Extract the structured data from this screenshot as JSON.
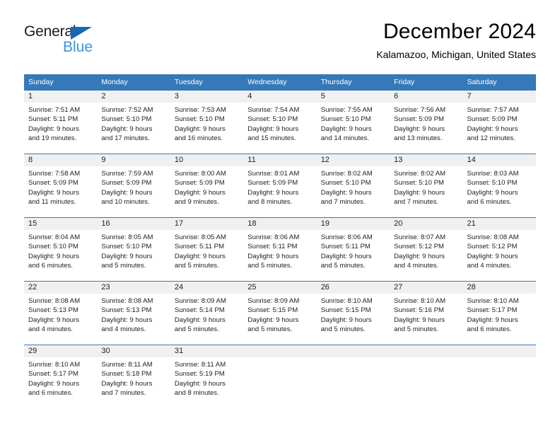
{
  "brand": {
    "word_one": "General",
    "word_two": "Blue",
    "triangle_icon": "brand-triangle-icon",
    "accent_dark": "#1668b3",
    "accent_light": "#3d93d8"
  },
  "header": {
    "title": "December 2024",
    "subtitle": "Kalamazoo, Michigan, United States"
  },
  "theme": {
    "header_blue": "#3579b8",
    "daynum_gray": "#f0f0f0",
    "text": "#222222"
  },
  "weekdays": [
    "Sunday",
    "Monday",
    "Tuesday",
    "Wednesday",
    "Thursday",
    "Friday",
    "Saturday"
  ],
  "weeks": [
    [
      {
        "day": "1",
        "sunrise": "Sunrise: 7:51 AM",
        "sunset": "Sunset: 5:11 PM",
        "daylight_line1": "Daylight: 9 hours",
        "daylight_line2": "and 19 minutes."
      },
      {
        "day": "2",
        "sunrise": "Sunrise: 7:52 AM",
        "sunset": "Sunset: 5:10 PM",
        "daylight_line1": "Daylight: 9 hours",
        "daylight_line2": "and 17 minutes."
      },
      {
        "day": "3",
        "sunrise": "Sunrise: 7:53 AM",
        "sunset": "Sunset: 5:10 PM",
        "daylight_line1": "Daylight: 9 hours",
        "daylight_line2": "and 16 minutes."
      },
      {
        "day": "4",
        "sunrise": "Sunrise: 7:54 AM",
        "sunset": "Sunset: 5:10 PM",
        "daylight_line1": "Daylight: 9 hours",
        "daylight_line2": "and 15 minutes."
      },
      {
        "day": "5",
        "sunrise": "Sunrise: 7:55 AM",
        "sunset": "Sunset: 5:10 PM",
        "daylight_line1": "Daylight: 9 hours",
        "daylight_line2": "and 14 minutes."
      },
      {
        "day": "6",
        "sunrise": "Sunrise: 7:56 AM",
        "sunset": "Sunset: 5:09 PM",
        "daylight_line1": "Daylight: 9 hours",
        "daylight_line2": "and 13 minutes."
      },
      {
        "day": "7",
        "sunrise": "Sunrise: 7:57 AM",
        "sunset": "Sunset: 5:09 PM",
        "daylight_line1": "Daylight: 9 hours",
        "daylight_line2": "and 12 minutes."
      }
    ],
    [
      {
        "day": "8",
        "sunrise": "Sunrise: 7:58 AM",
        "sunset": "Sunset: 5:09 PM",
        "daylight_line1": "Daylight: 9 hours",
        "daylight_line2": "and 11 minutes."
      },
      {
        "day": "9",
        "sunrise": "Sunrise: 7:59 AM",
        "sunset": "Sunset: 5:09 PM",
        "daylight_line1": "Daylight: 9 hours",
        "daylight_line2": "and 10 minutes."
      },
      {
        "day": "10",
        "sunrise": "Sunrise: 8:00 AM",
        "sunset": "Sunset: 5:09 PM",
        "daylight_line1": "Daylight: 9 hours",
        "daylight_line2": "and 9 minutes."
      },
      {
        "day": "11",
        "sunrise": "Sunrise: 8:01 AM",
        "sunset": "Sunset: 5:09 PM",
        "daylight_line1": "Daylight: 9 hours",
        "daylight_line2": "and 8 minutes."
      },
      {
        "day": "12",
        "sunrise": "Sunrise: 8:02 AM",
        "sunset": "Sunset: 5:10 PM",
        "daylight_line1": "Daylight: 9 hours",
        "daylight_line2": "and 7 minutes."
      },
      {
        "day": "13",
        "sunrise": "Sunrise: 8:02 AM",
        "sunset": "Sunset: 5:10 PM",
        "daylight_line1": "Daylight: 9 hours",
        "daylight_line2": "and 7 minutes."
      },
      {
        "day": "14",
        "sunrise": "Sunrise: 8:03 AM",
        "sunset": "Sunset: 5:10 PM",
        "daylight_line1": "Daylight: 9 hours",
        "daylight_line2": "and 6 minutes."
      }
    ],
    [
      {
        "day": "15",
        "sunrise": "Sunrise: 8:04 AM",
        "sunset": "Sunset: 5:10 PM",
        "daylight_line1": "Daylight: 9 hours",
        "daylight_line2": "and 6 minutes."
      },
      {
        "day": "16",
        "sunrise": "Sunrise: 8:05 AM",
        "sunset": "Sunset: 5:10 PM",
        "daylight_line1": "Daylight: 9 hours",
        "daylight_line2": "and 5 minutes."
      },
      {
        "day": "17",
        "sunrise": "Sunrise: 8:05 AM",
        "sunset": "Sunset: 5:11 PM",
        "daylight_line1": "Daylight: 9 hours",
        "daylight_line2": "and 5 minutes."
      },
      {
        "day": "18",
        "sunrise": "Sunrise: 8:06 AM",
        "sunset": "Sunset: 5:11 PM",
        "daylight_line1": "Daylight: 9 hours",
        "daylight_line2": "and 5 minutes."
      },
      {
        "day": "19",
        "sunrise": "Sunrise: 8:06 AM",
        "sunset": "Sunset: 5:11 PM",
        "daylight_line1": "Daylight: 9 hours",
        "daylight_line2": "and 5 minutes."
      },
      {
        "day": "20",
        "sunrise": "Sunrise: 8:07 AM",
        "sunset": "Sunset: 5:12 PM",
        "daylight_line1": "Daylight: 9 hours",
        "daylight_line2": "and 4 minutes."
      },
      {
        "day": "21",
        "sunrise": "Sunrise: 8:08 AM",
        "sunset": "Sunset: 5:12 PM",
        "daylight_line1": "Daylight: 9 hours",
        "daylight_line2": "and 4 minutes."
      }
    ],
    [
      {
        "day": "22",
        "sunrise": "Sunrise: 8:08 AM",
        "sunset": "Sunset: 5:13 PM",
        "daylight_line1": "Daylight: 9 hours",
        "daylight_line2": "and 4 minutes."
      },
      {
        "day": "23",
        "sunrise": "Sunrise: 8:08 AM",
        "sunset": "Sunset: 5:13 PM",
        "daylight_line1": "Daylight: 9 hours",
        "daylight_line2": "and 4 minutes."
      },
      {
        "day": "24",
        "sunrise": "Sunrise: 8:09 AM",
        "sunset": "Sunset: 5:14 PM",
        "daylight_line1": "Daylight: 9 hours",
        "daylight_line2": "and 5 minutes."
      },
      {
        "day": "25",
        "sunrise": "Sunrise: 8:09 AM",
        "sunset": "Sunset: 5:15 PM",
        "daylight_line1": "Daylight: 9 hours",
        "daylight_line2": "and 5 minutes."
      },
      {
        "day": "26",
        "sunrise": "Sunrise: 8:10 AM",
        "sunset": "Sunset: 5:15 PM",
        "daylight_line1": "Daylight: 9 hours",
        "daylight_line2": "and 5 minutes."
      },
      {
        "day": "27",
        "sunrise": "Sunrise: 8:10 AM",
        "sunset": "Sunset: 5:16 PM",
        "daylight_line1": "Daylight: 9 hours",
        "daylight_line2": "and 5 minutes."
      },
      {
        "day": "28",
        "sunrise": "Sunrise: 8:10 AM",
        "sunset": "Sunset: 5:17 PM",
        "daylight_line1": "Daylight: 9 hours",
        "daylight_line2": "and 6 minutes."
      }
    ],
    [
      {
        "day": "29",
        "sunrise": "Sunrise: 8:10 AM",
        "sunset": "Sunset: 5:17 PM",
        "daylight_line1": "Daylight: 9 hours",
        "daylight_line2": "and 6 minutes."
      },
      {
        "day": "30",
        "sunrise": "Sunrise: 8:11 AM",
        "sunset": "Sunset: 5:18 PM",
        "daylight_line1": "Daylight: 9 hours",
        "daylight_line2": "and 7 minutes."
      },
      {
        "day": "31",
        "sunrise": "Sunrise: 8:11 AM",
        "sunset": "Sunset: 5:19 PM",
        "daylight_line1": "Daylight: 9 hours",
        "daylight_line2": "and 8 minutes."
      },
      {
        "day": "",
        "sunrise": "",
        "sunset": "",
        "daylight_line1": "",
        "daylight_line2": ""
      },
      {
        "day": "",
        "sunrise": "",
        "sunset": "",
        "daylight_line1": "",
        "daylight_line2": ""
      },
      {
        "day": "",
        "sunrise": "",
        "sunset": "",
        "daylight_line1": "",
        "daylight_line2": ""
      },
      {
        "day": "",
        "sunrise": "",
        "sunset": "",
        "daylight_line1": "",
        "daylight_line2": ""
      }
    ]
  ]
}
